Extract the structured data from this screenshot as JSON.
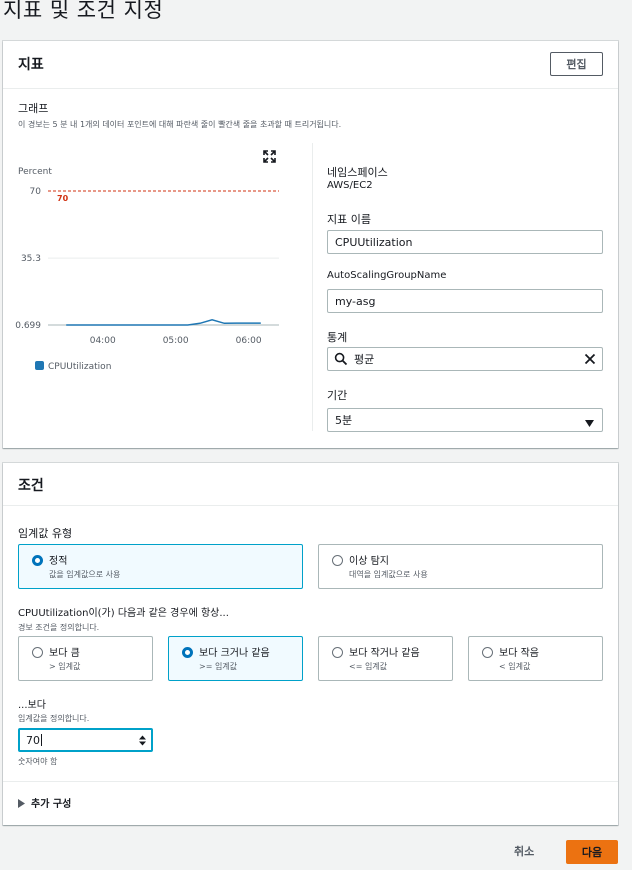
{
  "page": {
    "title": "지표 및 조건 지정"
  },
  "metric": {
    "header": "지표",
    "edit_label": "편집",
    "graph_label": "그래프",
    "graph_desc": "이 경보는 5 분 내 1개의 데이터 포인트에 대해 파란색 줄이 빨간색 줄을 초과할 때 트리거됩니다.",
    "namespace_label": "네임스페이스",
    "namespace_value": "AWS/EC2",
    "metric_name_label": "지표 이름",
    "metric_name_value": "CPUUtilization",
    "dimension_label": "AutoScalingGroupName",
    "dimension_value": "my-asg",
    "stat_label": "통계",
    "stat_value": "평균",
    "period_label": "기간",
    "period_value": "5분"
  },
  "chart_data": {
    "type": "line",
    "ylabel": "Percent",
    "y_ticks": [
      "70",
      "35.3",
      "0.699"
    ],
    "x_ticks": [
      "04:00",
      "05:00",
      "06:00"
    ],
    "threshold": {
      "value": 70,
      "label": "70",
      "color": "#d13212"
    },
    "series": [
      {
        "name": "CPUUtilization",
        "color": "#1f77b4",
        "x": [
          "03:30",
          "04:00",
          "04:30",
          "05:00",
          "05:10",
          "05:20",
          "05:30",
          "05:40",
          "05:50",
          "06:00",
          "06:10"
        ],
        "y": [
          0.699,
          0.699,
          0.699,
          0.699,
          0.699,
          1.6,
          3.4,
          1.6,
          1.7,
          1.7,
          1.7
        ]
      }
    ],
    "ylim": [
      0.699,
      70
    ],
    "legend": "bottom-left"
  },
  "condition": {
    "header": "조건",
    "threshold_type_label": "임계값 유형",
    "threshold_types": [
      {
        "title": "정적",
        "desc": "값을 임계값으로 사용",
        "selected": true
      },
      {
        "title": "이상 탐지",
        "desc": "대역을 임계값으로 사용",
        "selected": false
      }
    ],
    "whenever_label": "CPUUtilization이(가) 다음과 같은 경우에 항상...",
    "whenever_desc": "경보 조건을 정의합니다.",
    "operators": [
      {
        "title": "보다 큼",
        "desc": "> 임계값",
        "selected": false
      },
      {
        "title": "보다 크거나 같음",
        "desc": ">= 임계값",
        "selected": true
      },
      {
        "title": "보다 작거나 같음",
        "desc": "<= 임계값",
        "selected": false
      },
      {
        "title": "보다 작음",
        "desc": "< 임계값",
        "selected": false
      }
    ],
    "than_label": "...보다",
    "than_desc": "임계값을 정의합니다.",
    "threshold_value": "70",
    "than_hint": "숫자여야 함",
    "additional_config": "추가 구성"
  },
  "footer": {
    "cancel_label": "취소",
    "next_label": "다음"
  }
}
